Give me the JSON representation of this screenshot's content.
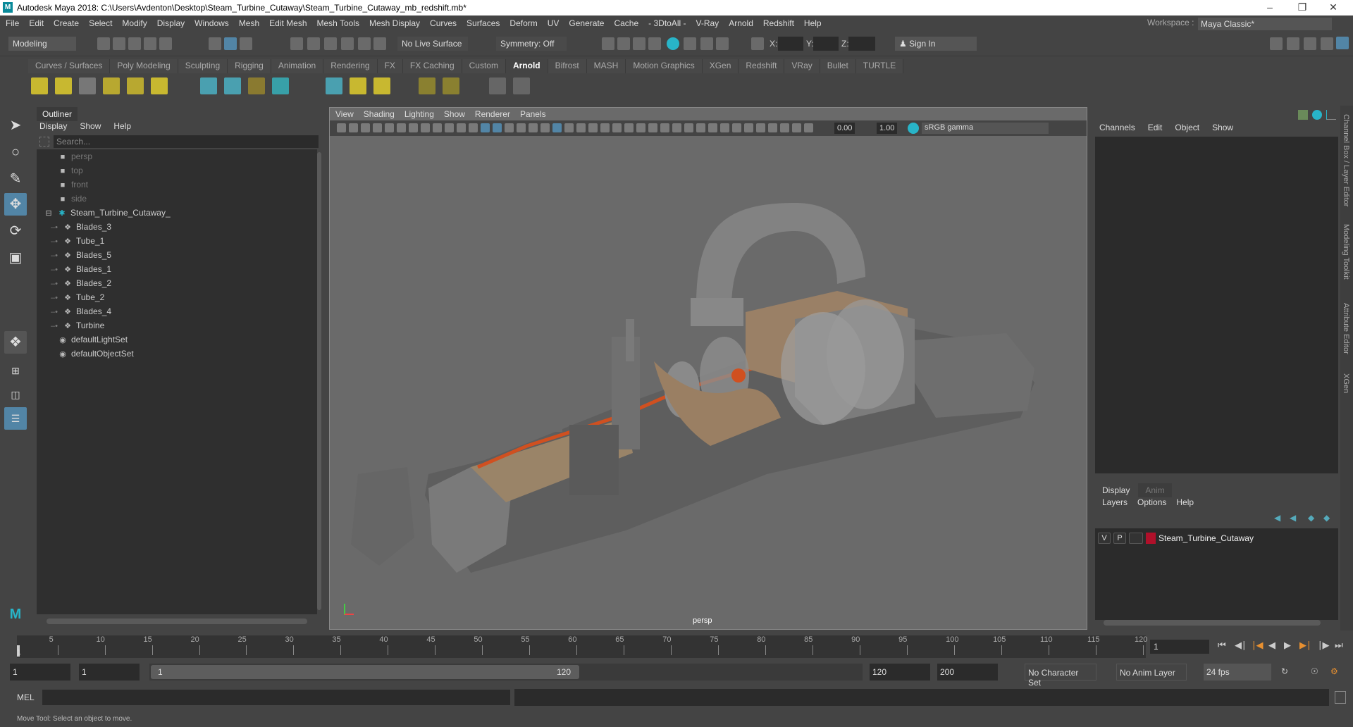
{
  "window": {
    "title": "Autodesk Maya 2018: C:\\Users\\Avdenton\\Desktop\\Steam_Turbine_Cutaway\\Steam_Turbine_Cutaway_mb_redshift.mb*",
    "logo": "M",
    "minimize": "–",
    "maximize": "❐",
    "close": "✕"
  },
  "menubar": [
    "File",
    "Edit",
    "Create",
    "Select",
    "Modify",
    "Display",
    "Windows",
    "Mesh",
    "Edit Mesh",
    "Mesh Tools",
    "Mesh Display",
    "Curves",
    "Surfaces",
    "Deform",
    "UV",
    "Generate",
    "Cache",
    "- 3DtoAll -",
    "V-Ray",
    "Arnold",
    "Redshift",
    "Help"
  ],
  "workspace": {
    "label": "Workspace :",
    "value": "Maya Classic*"
  },
  "toolbar": {
    "mode": "Modeling",
    "live_surface": "No Live Surface",
    "symmetry": "Symmetry: Off",
    "x_label": "X:",
    "y_label": "Y:",
    "z_label": "Z:",
    "sign_in": "Sign In"
  },
  "shelf_tabs": [
    "Curves / Surfaces",
    "Poly Modeling",
    "Sculpting",
    "Rigging",
    "Animation",
    "Rendering",
    "FX",
    "FX Caching",
    "Custom",
    "Arnold",
    "Bifrost",
    "MASH",
    "Motion Graphics",
    "XGen",
    "Redshift",
    "VRay",
    "Bullet",
    "TURTLE"
  ],
  "active_shelf": "Arnold",
  "outliner": {
    "tab": "Outliner",
    "menu": [
      "Display",
      "Show",
      "Help"
    ],
    "search_placeholder": "Search...",
    "cameras": [
      "persp",
      "top",
      "front",
      "side"
    ],
    "group": "Steam_Turbine_Cutaway_",
    "children": [
      "Blades_3",
      "Tube_1",
      "Blades_5",
      "Blades_1",
      "Blades_2",
      "Tube_2",
      "Blades_4",
      "Turbine"
    ],
    "sets": [
      "defaultLightSet",
      "defaultObjectSet"
    ]
  },
  "viewport": {
    "menu": [
      "View",
      "Shading",
      "Lighting",
      "Show",
      "Renderer",
      "Panels"
    ],
    "exposure": "0.00",
    "gamma": "1.00",
    "color_space": "sRGB gamma",
    "camera": "persp"
  },
  "channel_box": {
    "menu": [
      "Channels",
      "Edit",
      "Object",
      "Show"
    ]
  },
  "layer_editor": {
    "tabs": [
      "Display",
      "Anim"
    ],
    "menu": [
      "Layers",
      "Options",
      "Help"
    ],
    "layer": {
      "v": "V",
      "p": "P",
      "name": "Steam_Turbine_Cutaway",
      "color": "#b0102a"
    }
  },
  "side_tabs": [
    "Channel Box / Layer Editor",
    "Modeling Toolkit",
    "Attribute Editor",
    "XGen"
  ],
  "timeline": {
    "ticks": [
      "5",
      "10",
      "15",
      "20",
      "25",
      "30",
      "35",
      "40",
      "45",
      "50",
      "55",
      "60",
      "65",
      "70",
      "75",
      "80",
      "85",
      "90",
      "95",
      "100",
      "105",
      "110",
      "115",
      "120"
    ],
    "start_label": "1",
    "current_frame": "1",
    "min": 1,
    "max": 120
  },
  "range": {
    "start": "1",
    "anim_start": "1",
    "slider_start": "1",
    "slider_end": "120",
    "end": "120",
    "anim_end": "200",
    "character_set": "No Character Set",
    "anim_layer": "No Anim Layer",
    "fps": "24 fps"
  },
  "mel": {
    "label": "MEL"
  },
  "status": "Move Tool: Select an object to move.",
  "colors": {
    "accent": "#5285a6",
    "teal": "#28b4c8"
  }
}
